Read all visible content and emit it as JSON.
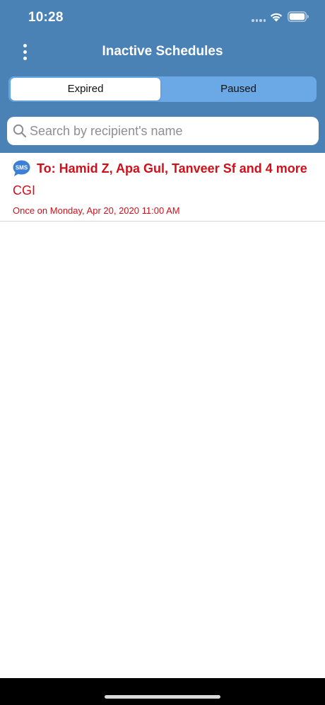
{
  "status_bar": {
    "time": "10:28",
    "icons": [
      "signal-dots-icon",
      "wifi-icon",
      "battery-icon"
    ]
  },
  "nav": {
    "title": "Inactive Schedules",
    "menu_icon": "more-vertical-icon"
  },
  "segments": [
    {
      "label": "Expired",
      "selected": true
    },
    {
      "label": "Paused",
      "selected": false
    }
  ],
  "search": {
    "placeholder": "Search by recipient's name",
    "value": "",
    "icon": "search-icon"
  },
  "schedules": [
    {
      "icon": "sms-icon",
      "to": "To: Hamid Z, Apa Gul, Tanveer Sf and 4 more",
      "message": "CGI",
      "when": "Once on Monday, Apr 20, 2020 11:00 AM"
    }
  ],
  "colors": {
    "header_bg": "#4a82b5",
    "segment_bg": "#6aa9e6",
    "expired_text": "#d0101a",
    "sms_icon": "#3b7fd6"
  }
}
